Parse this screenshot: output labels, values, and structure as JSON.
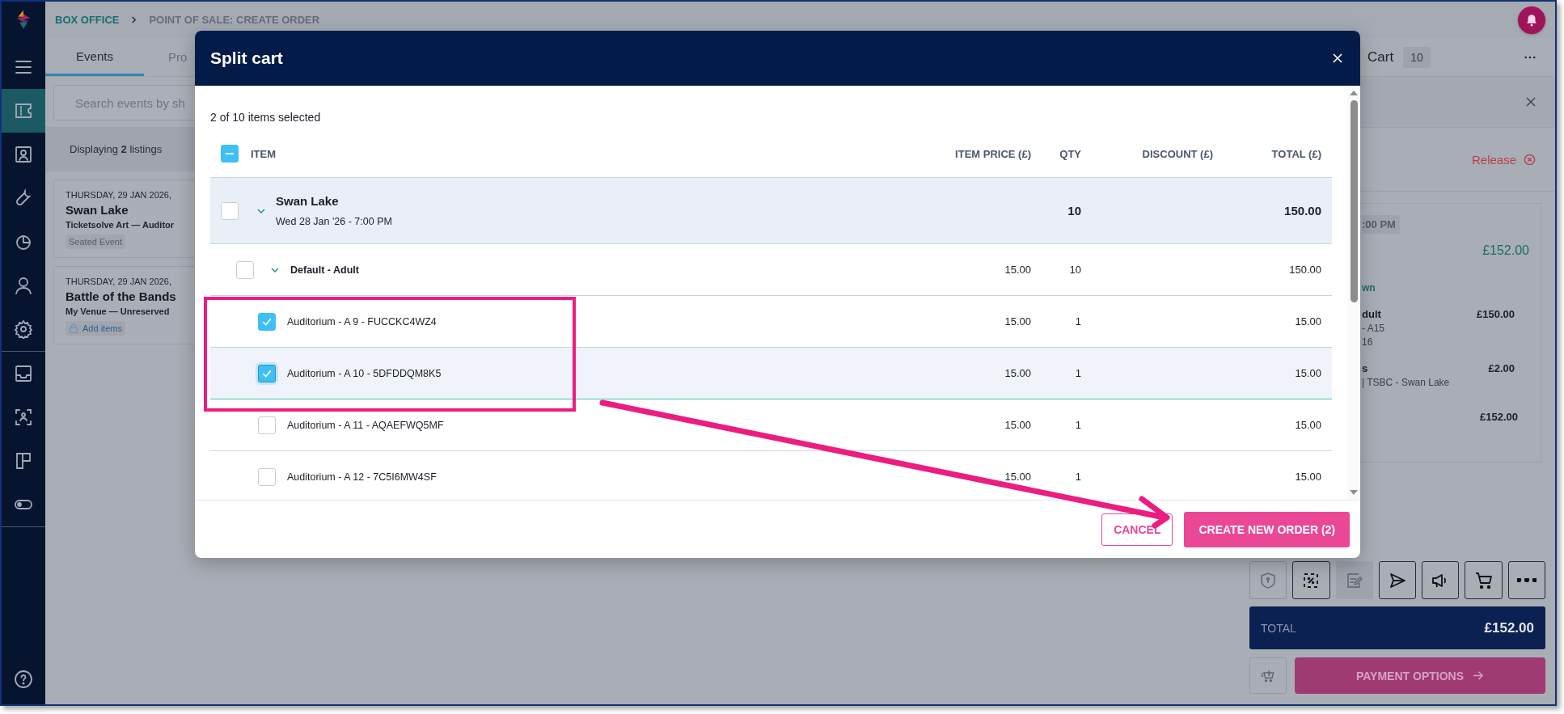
{
  "sidebar": {
    "sections": [
      {
        "items": [
          {
            "kind": "menu",
            "selected": false
          },
          {
            "kind": "ticket",
            "selected": true
          },
          {
            "kind": "contact",
            "selected": false
          },
          {
            "kind": "wrench",
            "selected": false
          },
          {
            "kind": "chart",
            "selected": false
          },
          {
            "kind": "person",
            "selected": false
          },
          {
            "kind": "gear",
            "selected": false
          }
        ]
      },
      {
        "items": [
          {
            "kind": "inbox",
            "selected": false
          },
          {
            "kind": "scan",
            "selected": false
          },
          {
            "kind": "layout",
            "selected": false
          },
          {
            "kind": "toggle",
            "selected": false
          }
        ]
      }
    ],
    "footer": [
      {
        "kind": "help",
        "selected": false
      }
    ]
  },
  "breadcrumb": [
    "BOX OFFICE",
    "POINT OF SALE: CREATE ORDER"
  ],
  "tabs": [
    {
      "label": "Events",
      "selected": true
    },
    {
      "label": "Pro",
      "selected": false
    }
  ],
  "search": {
    "placeholder": "Search events by sh"
  },
  "listing_summary": "Displaying **2** listings",
  "events": [
    {
      "date": "THURSDAY, 29 JAN 2026,",
      "title": "Swan Lake",
      "venue": "Ticketsolve Art — Auditor",
      "tag": {
        "kind": "label",
        "text": "Seated Event"
      }
    },
    {
      "date": "THURSDAY, 29 JAN 2026,",
      "title": "Battle of the Bands",
      "venue": "My Venue — Unreserved",
      "tag": {
        "kind": "link",
        "text": "Add items"
      }
    }
  ],
  "cart": {
    "tab": "Cart",
    "count": "10",
    "release": "Release",
    "ticket": {
      "time": ":00 PM",
      "price": "£152.00",
      "link": "wn",
      "lines": [
        {
          "name": "dult",
          "details": [
            "- A15",
            "16"
          ],
          "amount": "£150.00"
        },
        {
          "name": "s",
          "details": [
            "| TSBC - Swan Lake"
          ],
          "amount": "£2.00"
        }
      ],
      "total": "£152.00"
    },
    "tools": [
      {
        "kind": "shield",
        "disabled": true
      },
      {
        "kind": "discount",
        "disabled": false
      },
      {
        "kind": "note",
        "disabled": true
      },
      {
        "kind": "send",
        "disabled": false
      },
      {
        "kind": "megaphone",
        "disabled": false
      },
      {
        "kind": "cart",
        "disabled": false
      },
      {
        "kind": "more",
        "disabled": false
      }
    ],
    "total": {
      "label": "TOTAL",
      "amount": "£152.00"
    },
    "payment": "PAYMENT OPTIONS"
  },
  "modal": {
    "title": "Split cart",
    "summary": "2 of 10 items selected",
    "select_all": {
      "indeterminate": true
    },
    "columns": [
      "ITEM",
      "ITEM PRICE (£)",
      "QTY",
      "DISCOUNT (£)",
      "TOTAL (£)"
    ],
    "rows": [
      {
        "title": "Swan Lake",
        "subtitle": "Wed 28 Jan '26 - 7:00 PM",
        "qty": "10",
        "total": "150.00",
        "checked": false,
        "expanded": true,
        "children": [
          {
            "title": "Default - Adult",
            "price": "15.00",
            "qty": "10",
            "total": "150.00",
            "checked": false,
            "expanded": true,
            "children": [
              {
                "title": "Auditorium - A 9 - FUCCKC4WZ4",
                "price": "15.00",
                "qty": "1",
                "total": "15.00",
                "checked": true,
                "focused": false
              },
              {
                "title": "Auditorium - A 10 - 5DFDDQM8K5",
                "price": "15.00",
                "qty": "1",
                "total": "15.00",
                "checked": true,
                "focused": true
              },
              {
                "title": "Auditorium - A 11 - AQAEFWQ5MF",
                "price": "15.00",
                "qty": "1",
                "total": "15.00",
                "checked": false,
                "focused": false
              },
              {
                "title": "Auditorium - A 12 - 7C5I6MW4SF",
                "price": "15.00",
                "qty": "1",
                "total": "15.00",
                "checked": false,
                "focused": false
              }
            ]
          }
        ]
      }
    ],
    "buttons": [
      {
        "kind": "secondary",
        "label": "CANCEL"
      },
      {
        "kind": "primary",
        "label": "CREATE NEW ORDER (2)"
      }
    ]
  }
}
